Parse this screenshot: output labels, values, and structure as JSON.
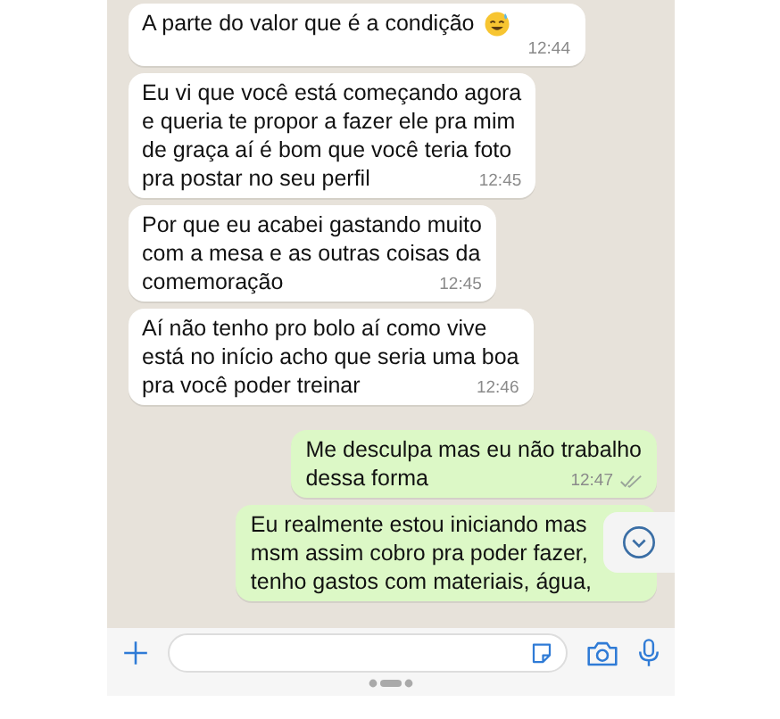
{
  "messages": [
    {
      "kind": "incoming",
      "lines": [
        "A parte do valor que é a condição"
      ],
      "emoji": true,
      "time": "12:44"
    },
    {
      "kind": "incoming",
      "lines": [
        "Eu vi que você está começando agora",
        "e queria te propor a fazer ele pra mim",
        "de graça aí é bom que você teria foto",
        "pra postar no seu perfil"
      ],
      "time": "12:45"
    },
    {
      "kind": "incoming",
      "lines": [
        "Por que eu acabei gastando muito",
        "com a mesa e as outras coisas da",
        "comemoração"
      ],
      "time": "12:45"
    },
    {
      "kind": "incoming",
      "lines": [
        "Aí não tenho pro bolo aí como vive",
        "está no início acho que seria uma boa",
        "pra você poder treinar"
      ],
      "time": "12:46"
    },
    {
      "kind": "outgoing",
      "lines": [
        "Me desculpa mas eu não trabalho",
        "dessa forma"
      ],
      "time": "12:47",
      "read": false
    },
    {
      "kind": "outgoing",
      "lines": [
        "Eu realmente estou iniciando mas",
        "msm assim cobro pra poder fazer,",
        "tenho gastos com materiais, água,"
      ]
    }
  ]
}
